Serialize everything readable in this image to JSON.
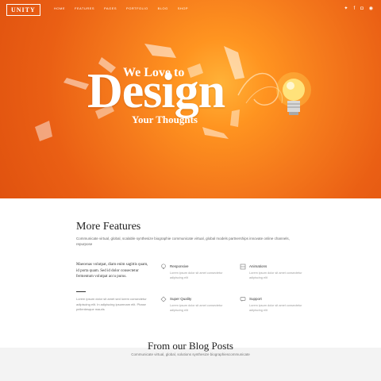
{
  "nav": {
    "logo": "UNITY",
    "menu": [
      "HOME",
      "FEATURES",
      "PAGES",
      "PORTFOLIO",
      "BLOG",
      "SHOP"
    ],
    "social": [
      "twitter-icon",
      "facebook-icon",
      "instagram-icon",
      "feed-icon"
    ]
  },
  "hero": {
    "line1": "We Love to",
    "line2": "Design",
    "line3": "Your Thoughts"
  },
  "features": {
    "title": "More Features",
    "subtitle": "Communicate virtual, global, scalable synthesize biographie communicate virtual, global models partnerships innovate online channels, repurpose",
    "intro": "Maecenas volutpat, diam enim sagittis quam, id porta quam. Sed id dolor consectetur fermentum volutpat accu purus.",
    "intro_sub": "Lorem ipsum dolor sit amet sed lorem consectetur adipiscing elit. In adipiscing ipsumnam elit. Phase pellentesque mauris",
    "items": [
      {
        "icon": "lightbulb-icon",
        "title": "Responsive",
        "desc": "Lorem ipsum dolor sit amet consectetur adipiscing elit"
      },
      {
        "icon": "layers-icon",
        "title": "Animations",
        "desc": "Lorem ipsum dolor sit amet consectetur adipiscing elit"
      },
      {
        "icon": "diamond-icon",
        "title": "Super Quality",
        "desc": "Lorem ipsum dolor sit amet consectetur adipiscing elit"
      },
      {
        "icon": "chat-icon",
        "title": "Support",
        "desc": "Lorem ipsum dolor sit amet consectetur adipiscing elit"
      }
    ]
  },
  "blog": {
    "title": "From our Blog Posts",
    "subtitle": "Communicate virtual, global, solutions synthesize biographiescommunicate"
  }
}
